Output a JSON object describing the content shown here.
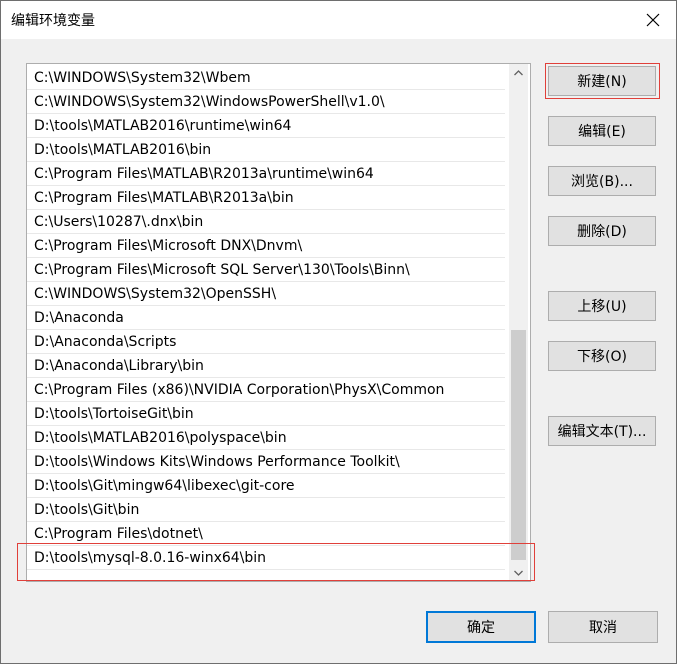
{
  "window": {
    "title": "编辑环境变量",
    "close_icon": "close-icon"
  },
  "path_list": {
    "items": [
      "C:\\WINDOWS\\System32\\Wbem",
      "C:\\WINDOWS\\System32\\WindowsPowerShell\\v1.0\\",
      "D:\\tools\\MATLAB2016\\runtime\\win64",
      "D:\\tools\\MATLAB2016\\bin",
      "C:\\Program Files\\MATLAB\\R2013a\\runtime\\win64",
      "C:\\Program Files\\MATLAB\\R2013a\\bin",
      "C:\\Users\\10287\\.dnx\\bin",
      "C:\\Program Files\\Microsoft DNX\\Dnvm\\",
      "C:\\Program Files\\Microsoft SQL Server\\130\\Tools\\Binn\\",
      "C:\\WINDOWS\\System32\\OpenSSH\\",
      "D:\\Anaconda",
      "D:\\Anaconda\\Scripts",
      "D:\\Anaconda\\Library\\bin",
      "C:\\Program Files (x86)\\NVIDIA Corporation\\PhysX\\Common",
      "D:\\tools\\TortoiseGit\\bin",
      "D:\\tools\\MATLAB2016\\polyspace\\bin",
      "D:\\tools\\Windows Kits\\Windows Performance Toolkit\\",
      "D:\\tools\\Git\\mingw64\\libexec\\git-core",
      "D:\\tools\\Git\\bin",
      "C:\\Program Files\\dotnet\\",
      "D:\\tools\\mysql-8.0.16-winx64\\bin"
    ]
  },
  "buttons": {
    "new": "新建(N)",
    "edit": "编辑(E)",
    "browse": "浏览(B)...",
    "delete": "删除(D)",
    "move_up": "上移(U)",
    "move_down": "下移(O)",
    "edit_text": "编辑文本(T)...",
    "ok": "确定",
    "cancel": "取消"
  },
  "colors": {
    "highlight_annotation": "#e0403a",
    "focus_border": "#0078d7"
  }
}
